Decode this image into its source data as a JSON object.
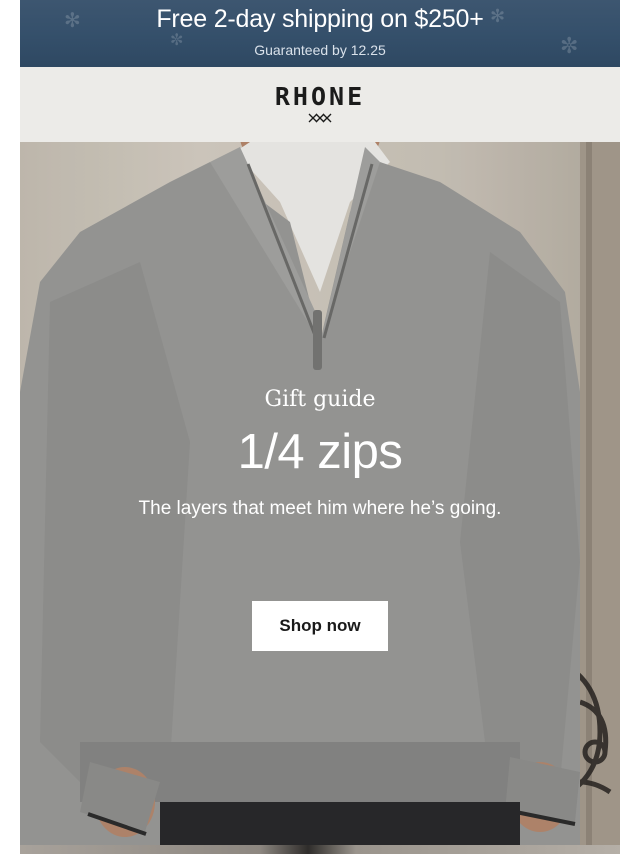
{
  "banner": {
    "headline": "Free 2-day shipping on $250+",
    "subline": "Guaranteed by 12.25",
    "background_color": "#35506b"
  },
  "brand": {
    "name": "RHONE",
    "mark_icon": "xxx-logo-mark-icon"
  },
  "hero": {
    "eyebrow": "Gift guide",
    "title": "1/4 zips",
    "tagline": "The layers that meet him where he’s going.",
    "cta_label": "Shop now",
    "image_subject": "man-in-gray-quarter-zip-sweater"
  }
}
